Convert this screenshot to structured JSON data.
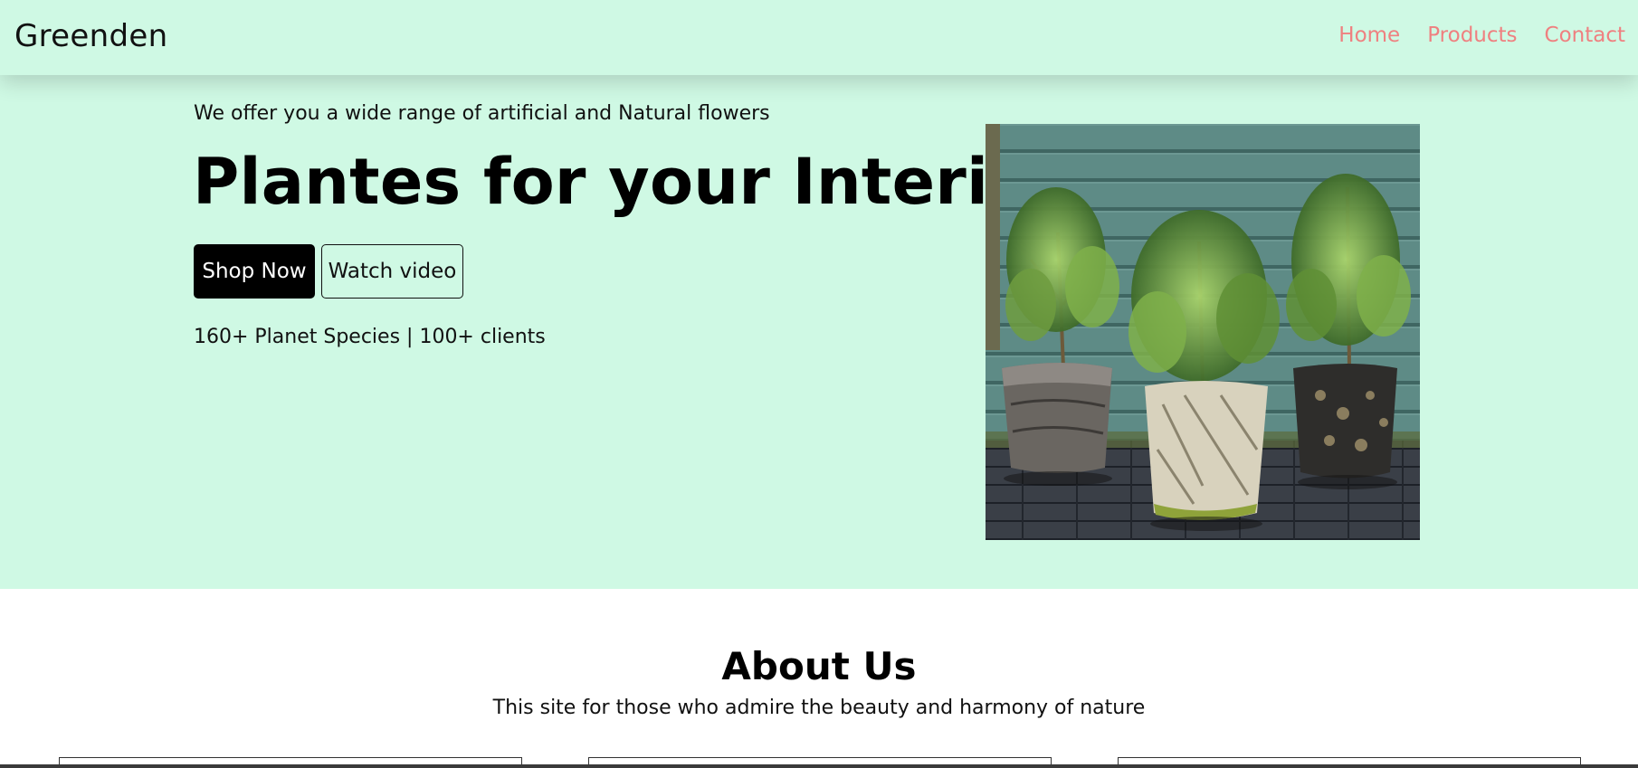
{
  "nav": {
    "brand": "Greenden",
    "links": [
      "Home",
      "Products",
      "Contact"
    ]
  },
  "hero": {
    "tagline": "We offer you a wide range of artificial and Natural flowers",
    "headline": "Plantes for your Interior",
    "shop_button": "Shop Now",
    "video_button": "Watch video",
    "stats": "160+ Planet Species | 100+ clients",
    "image_icon": "potted-plants-photo"
  },
  "about": {
    "title": "About Us",
    "subtitle": "This site for those who admire the beauty and harmony of nature",
    "cards": [
      "",
      "",
      ""
    ]
  },
  "colors": {
    "hero_bg": "#cff9e4",
    "nav_link": "#ef8080",
    "primary_button_bg": "#000000"
  }
}
